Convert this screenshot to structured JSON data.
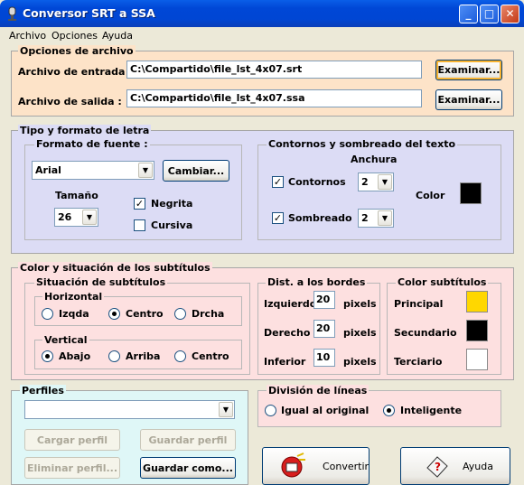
{
  "window": {
    "title": "Conversor SRT a SSA"
  },
  "menu": [
    {
      "label": "Archivo"
    },
    {
      "label": "Opciones"
    },
    {
      "label": "Ayuda"
    }
  ],
  "file_options": {
    "title": "Opciones de archivo",
    "input_label": "Archivo de entrada :",
    "input_value": "C:\\Compartido\\file_lst_4x07.srt",
    "output_label": "Archivo de salida :",
    "output_value": "C:\\Compartido\\file_lst_4x07.ssa",
    "browse_label": "Examinar..."
  },
  "font_section": {
    "title": "Tipo y formato de letra",
    "format_title": "Formato de fuente  :",
    "font_value": "Arial",
    "change_label": "Cambiar...",
    "size_label": "Tamaño",
    "size_value": "26",
    "bold_label": "Negrita",
    "bold_checked": true,
    "italic_label": "Cursiva",
    "italic_checked": false,
    "outline_title": "Contornos y sombreado del texto",
    "width_label": "Anchura",
    "outline_label": "Contornos",
    "outline_checked": true,
    "outline_value": "2",
    "shadow_label": "Sombreado",
    "shadow_checked": true,
    "shadow_value": "2",
    "color_label": "Color",
    "color": "#000000"
  },
  "subtitle_section": {
    "title": "Color y situación de los subtítulos",
    "position_title": "Situación de subtítulos",
    "horizontal_title": "Horizontal",
    "horizontal_options": [
      "Izqda",
      "Centro",
      "Drcha"
    ],
    "horizontal_selected": "Centro",
    "vertical_title": "Vertical",
    "vertical_options": [
      "Abajo",
      "Arriba",
      "Centro"
    ],
    "vertical_selected": "Abajo",
    "borders_title": "Dist. a los bordes",
    "left_label": "Izquierdo",
    "left_value": "20",
    "right_label": "Derecho",
    "right_value": "20",
    "bottom_label": "Inferior",
    "bottom_value": "10",
    "unit": "pixels",
    "colors_title": "Color subtítulos",
    "primary_label": "Principal",
    "primary_color": "#ffd700",
    "secondary_label": "Secundario",
    "secondary_color": "#000000",
    "tertiary_label": "Terciario",
    "tertiary_color": "#ffffff"
  },
  "profiles": {
    "title": "Perfiles",
    "selected": "",
    "load_label": "Cargar perfil",
    "save_label": "Guardar perfil",
    "delete_label": "Eliminar perfil...",
    "save_as_label": "Guardar como..."
  },
  "line_split": {
    "title": "División de líneas",
    "options": [
      "Igual al original",
      "Inteligente"
    ],
    "selected": "Inteligente"
  },
  "actions": {
    "convert_label": "Convertir",
    "help_label": "Ayuda"
  }
}
